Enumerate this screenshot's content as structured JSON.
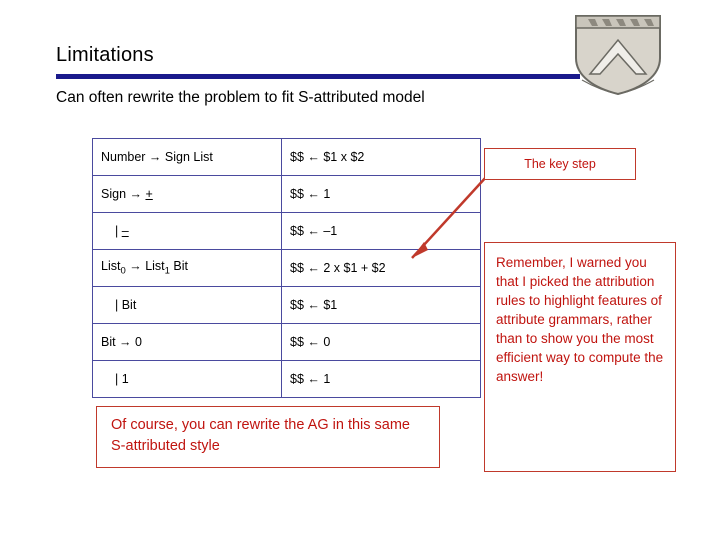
{
  "slide": {
    "title": "Limitations",
    "subtitle": "Can often rewrite the problem to fit S-attributed model"
  },
  "crest": {
    "icon": "rice-university-crest-icon"
  },
  "grammar": {
    "rows": [
      {
        "lhs": "Number → Sign List",
        "rhs": "$$ ← $1 x $2",
        "indent": false,
        "lhs_sub": ""
      },
      {
        "lhs": "Sign → +",
        "rhs": "$$ ← 1",
        "indent": false,
        "lhs_sub": ""
      },
      {
        "lhs": "|  –",
        "rhs": "$$ ← –1",
        "indent": true,
        "lhs_sub": ""
      },
      {
        "lhs": "List0 → List1 Bit",
        "rhs": "$$ ← 2 x $1 + $2",
        "indent": false,
        "lhs_sub": ""
      },
      {
        "lhs": "|  Bit",
        "rhs": "$$ ← $1",
        "indent": true,
        "lhs_sub": ""
      },
      {
        "lhs": "Bit → 0",
        "rhs": "$$ ← 0",
        "indent": false,
        "lhs_sub": ""
      },
      {
        "lhs": "|  1",
        "rhs": "$$ ← 1",
        "indent": true,
        "lhs_sub": ""
      }
    ]
  },
  "callouts": {
    "key_step": "The key step",
    "remember": "Remember, I warned you that I picked the attribution rules to highlight features of attribute grammars, rather than to show you the most efficient way to compute the answer!",
    "of_course": "Of course, you can rewrite the AG in this same S-attributed style"
  },
  "colors": {
    "rule": "#1a1a8c",
    "table_border": "#4a4a9e",
    "callout_border": "#c0392b",
    "callout_text": "#c0140f"
  }
}
